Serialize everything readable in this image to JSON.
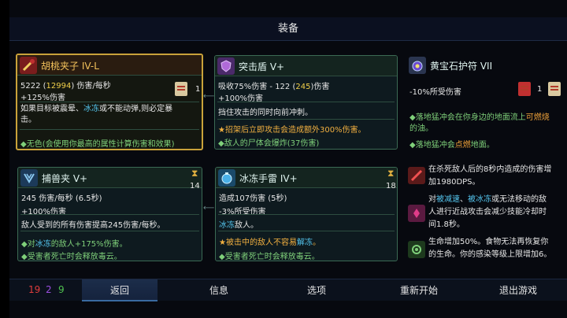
{
  "title": "装备",
  "cards": {
    "c1": {
      "title": "胡桃夹子 IV-L",
      "l1a": "5222 (",
      "l1b": "12994",
      "l1c": ") 伤害/每秒",
      "l2": "+125%伤害",
      "desc": "如果目标被震晕、冰冻或不能动弹,则必定暴击。",
      "d1": "如果目标被震晕、",
      "d2": "冰冻",
      "d3": "或不能动弹,则必定暴",
      "d4": "击。",
      "bonus": "◆无色(会使用你最高的属性计算伤害和效果)",
      "count": "1",
      "icon": "nutcracker-icon",
      "color": "#c9a23a"
    },
    "c2": {
      "title": "突击盾 V+",
      "l1a": "吸收75%伤害 - 122 (",
      "l1b": "245",
      "l1c": ")伤害",
      "l2": "+100%伤害",
      "desc": "挡住攻击的同时向前冲刺。",
      "b1": "★招架后立即攻击会造成额外300%伤害。",
      "b2": "◆敌人的尸体会爆炸(37伤害)",
      "icon": "shield-icon"
    },
    "c3": {
      "title": "黄宝石护符 VII",
      "l1": "-10%所受伤害",
      "b1": "◆落地猛冲会在你身边的地面流上可燃烧的油。",
      "b1a": "◆落地猛冲会在你身边的地面流上",
      "b1b": "可燃烧",
      "b1c": "的油。",
      "b2a": "◆落地猛冲会",
      "b2b": "点燃",
      "b2c": "地面。",
      "count": "1",
      "icon": "amulet-icon"
    },
    "c4": {
      "title": "捕兽夹 V+",
      "l1": "245 伤害/每秒 (6.5秒)",
      "l2": "+100%伤害",
      "desc": "敌人受到的所有伤害提高245伤害/每秒。",
      "b1a": "◆对",
      "b1b": "冰冻",
      "b1c": "的敌人+175%伤害。",
      "b2": "◆受害者死亡时会释放毒云。",
      "cooldown": "14",
      "icon": "trap-icon"
    },
    "c5": {
      "title": "冰冻手雷 IV+",
      "l1": "造成107伤害 (5秒)",
      "l2": "-3%所受伤害",
      "d1": "冰冻",
      "d2": "敌人。",
      "b1a": "★被击中的敌人不容易",
      "b1b": "解冻",
      "b1c": "。",
      "b2": "◆受害者死亡时会释放毒云。",
      "cooldown": "18",
      "icon": "grenade-icon"
    }
  },
  "mutations": [
    {
      "icon": "kill-rage-icon",
      "l1": "在杀死敌人后的8秒内造成的伤害增",
      "l2": "加1980DPS。"
    },
    {
      "icon": "melee-slow-icon",
      "l1a": "对",
      "l1b": "被减速",
      "l1c": "、",
      "l1d": "被冰冻",
      "l1e": "或无法移动的敌",
      "l2": "人进行近战攻击会减少技能冷却时",
      "l3": "间1.8秒。"
    },
    {
      "icon": "vitality-icon",
      "l1": "生命增加50%。食物无法再恢复你",
      "l2": "的生命。你的感染等级上限增加6。"
    }
  ],
  "stats": {
    "brutality": "19",
    "tactics": "2",
    "survival": "9"
  },
  "menu": {
    "back": "返回",
    "info": "信息",
    "options": "选项",
    "restart": "重新开始",
    "quit": "退出游戏"
  },
  "colors": {
    "brutality": "#e03c3c",
    "tactics": "#9a4fe0",
    "survival": "#4fc04f",
    "gold": "#c9a23a"
  }
}
